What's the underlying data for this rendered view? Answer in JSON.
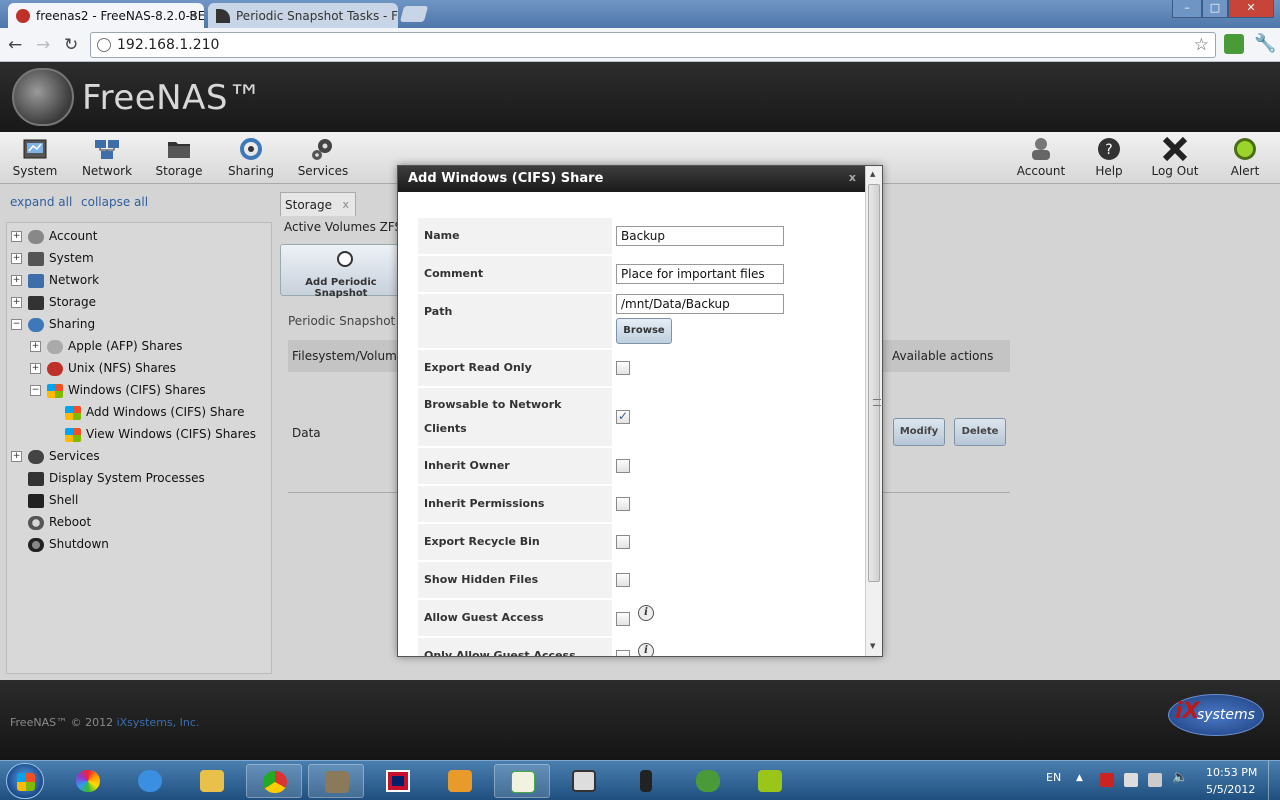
{
  "browser": {
    "tabs": [
      {
        "label": "freenas2 - FreeNAS-8.2.0-BE",
        "active": true
      },
      {
        "label": "Periodic Snapshot Tasks - F",
        "active": false
      }
    ],
    "url": "192.168.1.210",
    "tab_close": "×"
  },
  "window_controls": {
    "minimize": "–",
    "maximize": "□",
    "close": "✕"
  },
  "header": {
    "logo_text": "FreeNAS™"
  },
  "toolbar": {
    "left": [
      {
        "label": "System",
        "icon": "system-icon"
      },
      {
        "label": "Network",
        "icon": "network-icon"
      },
      {
        "label": "Storage",
        "icon": "storage-icon"
      },
      {
        "label": "Sharing",
        "icon": "sharing-icon"
      },
      {
        "label": "Services",
        "icon": "services-icon"
      }
    ],
    "right": [
      {
        "label": "Account",
        "icon": "account-icon"
      },
      {
        "label": "Help",
        "icon": "help-icon"
      },
      {
        "label": "Log Out",
        "icon": "logout-icon"
      },
      {
        "label": "Alert",
        "icon": "alert-icon"
      }
    ]
  },
  "sidebar": {
    "expand_all": "expand all",
    "collapse_all": "collapse all",
    "tree": [
      {
        "label": "Account",
        "level": 0,
        "pm": "+"
      },
      {
        "label": "System",
        "level": 0,
        "pm": "+"
      },
      {
        "label": "Network",
        "level": 0,
        "pm": "+"
      },
      {
        "label": "Storage",
        "level": 0,
        "pm": "+"
      },
      {
        "label": "Sharing",
        "level": 0,
        "pm": "−"
      },
      {
        "label": "Apple (AFP) Shares",
        "level": 1,
        "pm": "+"
      },
      {
        "label": "Unix (NFS) Shares",
        "level": 1,
        "pm": "+"
      },
      {
        "label": "Windows (CIFS) Shares",
        "level": 1,
        "pm": "−"
      },
      {
        "label": "Add Windows (CIFS) Share",
        "level": 2,
        "pm": ""
      },
      {
        "label": "View Windows (CIFS) Shares",
        "level": 2,
        "pm": ""
      },
      {
        "label": "Services",
        "level": 0,
        "pm": "+"
      },
      {
        "label": "Display System Processes",
        "level": 0,
        "pm": ""
      },
      {
        "label": "Shell",
        "level": 0,
        "pm": ""
      },
      {
        "label": "Reboot",
        "level": 0,
        "pm": ""
      },
      {
        "label": "Shutdown",
        "level": 0,
        "pm": ""
      }
    ]
  },
  "content": {
    "tab_label": "Storage",
    "tab_close": "x",
    "subnav": "Active Volumes   ZFS",
    "add_button": "Add Periodic Snapshot",
    "section_title": "Periodic Snapshot S",
    "table_headers": [
      "Filesystem/Volume",
      "Available actions"
    ],
    "row_value": "Data",
    "modify": "Modify",
    "delete": "Delete"
  },
  "modal": {
    "title": "Add Windows (CIFS) Share",
    "close": "x",
    "fields": [
      {
        "label": "Name",
        "type": "text",
        "value": "Backup"
      },
      {
        "label": "Comment",
        "type": "text",
        "value": "Place for important files"
      },
      {
        "label": "Path",
        "type": "path",
        "value": "/mnt/Data/Backup",
        "button": "Browse"
      },
      {
        "label": "Export Read Only",
        "type": "checkbox",
        "checked": false
      },
      {
        "label": "Browsable to Network Clients",
        "type": "checkbox",
        "checked": true
      },
      {
        "label": "Inherit Owner",
        "type": "checkbox",
        "checked": false
      },
      {
        "label": "Inherit Permissions",
        "type": "checkbox",
        "checked": false
      },
      {
        "label": "Export Recycle Bin",
        "type": "checkbox",
        "checked": false
      },
      {
        "label": "Show Hidden Files",
        "type": "checkbox",
        "checked": false
      },
      {
        "label": "Allow Guest Access",
        "type": "checkbox",
        "checked": false,
        "info": true
      },
      {
        "label": "Only Allow Guest Access",
        "type": "checkbox",
        "checked": false,
        "info": true
      }
    ],
    "info_glyph": "i"
  },
  "footer": {
    "copyright": "FreeNAS™ © 2012 ",
    "company": "iXsystems, Inc.",
    "logo_text": "systems",
    "logo_prefix": "iX"
  },
  "taskbar": {
    "items": [
      "picasa-icon",
      "ie-icon",
      "explorer-icon",
      "chrome-icon",
      "gimp-icon",
      "uk-flag-icon",
      "outlook-icon",
      "notepad-icon",
      "apps-icon",
      "phone-icon",
      "evernote-icon",
      "vmware-icon"
    ],
    "lang": "EN",
    "time": "10:53 PM",
    "date": "5/5/2012"
  },
  "colors": {
    "accent_link": "#2f5f9e",
    "modal_title_bg": "#2a2a2a",
    "header_bg": "#1f1f1f"
  }
}
